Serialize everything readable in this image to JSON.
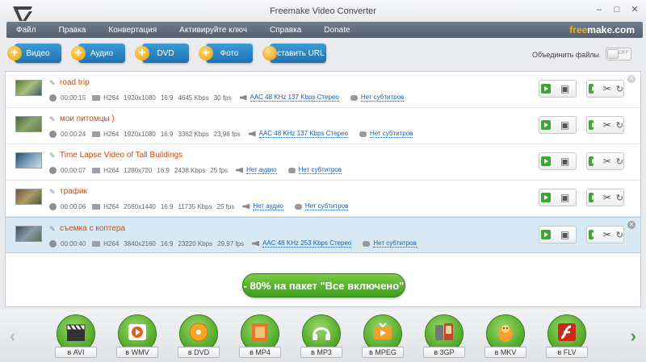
{
  "window": {
    "title": "Freemake Video Converter",
    "controls": [
      "–",
      "□",
      "✕"
    ]
  },
  "menu": {
    "items": [
      "Файл",
      "Правка",
      "Конвертация",
      "Активируйте ключ",
      "Справка",
      "Donate"
    ],
    "brand_part1": "free",
    "brand_part2": "make.com"
  },
  "toolbar": {
    "buttons": [
      "Видео",
      "Аудио",
      "DVD",
      "Фото",
      "Вставить URL"
    ],
    "join_files_label": "Объединить файлы",
    "toggle_state": "OFF"
  },
  "files": [
    {
      "name": "road trip",
      "duration": "00:00:15",
      "codec": "H264",
      "resolution": "1920x1080",
      "aspect": "16:9",
      "bitrate": "4645 Kbps",
      "fps": "30 fps",
      "audio": "AAC  48 KHz  137 Kbps  Стерео",
      "subs": "Нет субтитров",
      "selected": false
    },
    {
      "name": "мои питомцы )",
      "duration": "00:00:24",
      "codec": "H264",
      "resolution": "1920x1080",
      "aspect": "16:9",
      "bitrate": "3362 Kbps",
      "fps": "23,98 fps",
      "audio": "AAC  48 KHz  137 Kbps  Стерео",
      "subs": "Нет субтитров",
      "selected": false
    },
    {
      "name": "Time Lapse Video of Tall Buildings",
      "duration": "00:00:07",
      "codec": "H264",
      "resolution": "1280x720",
      "aspect": "16:9",
      "bitrate": "2438 Kbps",
      "fps": "25 fps",
      "audio": "Нет аудио",
      "subs": "Нет субтитров",
      "selected": false
    },
    {
      "name": "трафик",
      "duration": "00:00:06",
      "codec": "H264",
      "resolution": "2560x1440",
      "aspect": "16:9",
      "bitrate": "11735 Kbps",
      "fps": "25 fps",
      "audio": "Нет аудио",
      "subs": "Нет субтитров",
      "selected": false
    },
    {
      "name": "съемка с коптера",
      "duration": "00:00:40",
      "codec": "H264",
      "resolution": "3840x2160",
      "aspect": "16:9",
      "bitrate": "23220 Kbps",
      "fps": "29,97 fps",
      "audio": "AAC  48 KHz  253 Kbps  Стерео",
      "subs": "Нет субтитров",
      "selected": true
    }
  ],
  "promo": {
    "label": "- 80% на пакет \"Все включено\""
  },
  "formats": [
    "в AVI",
    "в WMV",
    "в DVD",
    "в MP4",
    "в MP3",
    "в MPEG",
    "в 3GP",
    "в MKV",
    "в FLV"
  ],
  "colors": {
    "accent_green": "#3fa535",
    "toolbar_blue": "#1d73b5",
    "title_orange": "#c84b11",
    "brand_yellow": "#f5b400",
    "menubar": "#5f6b7a"
  }
}
